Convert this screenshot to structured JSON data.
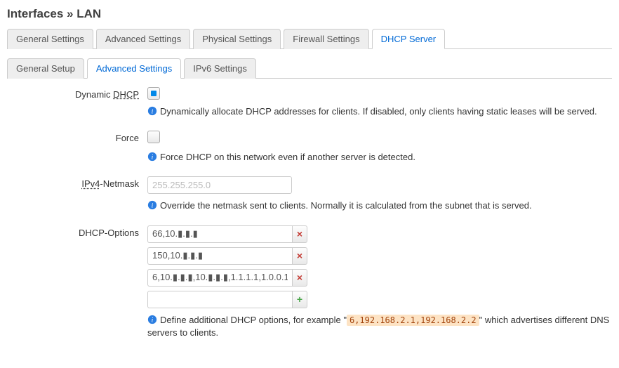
{
  "page_title_prefix": "Interfaces",
  "page_title_sep": " » ",
  "page_title_suffix": "LAN",
  "main_tabs": [
    {
      "label": "General Settings",
      "active": false
    },
    {
      "label": "Advanced Settings",
      "active": false
    },
    {
      "label": "Physical Settings",
      "active": false
    },
    {
      "label": "Firewall Settings",
      "active": false
    },
    {
      "label": "DHCP Server",
      "active": true
    }
  ],
  "sub_tabs": [
    {
      "label": "General Setup",
      "active": false
    },
    {
      "label": "Advanced Settings",
      "active": true
    },
    {
      "label": "IPv6 Settings",
      "active": false
    }
  ],
  "fields": {
    "dynamic_dhcp": {
      "label_pre": "Dynamic ",
      "label_abbr": "DHCP",
      "checked": true,
      "hint": "Dynamically allocate DHCP addresses for clients. If disabled, only clients having static leases will be served."
    },
    "force": {
      "label": "Force",
      "checked": false,
      "hint": "Force DHCP on this network even if another server is detected."
    },
    "ipv4_netmask": {
      "label_abbr": "IPv4",
      "label_post": "-Netmask",
      "placeholder": "255.255.255.0",
      "value": "",
      "hint": "Override the netmask sent to clients. Normally it is calculated from the subnet that is served."
    },
    "dhcp_options": {
      "label": "DHCP-Options",
      "entries": [
        "66,10.▮.▮.▮",
        "150,10.▮.▮.▮",
        "6,10.▮.▮.▮,10.▮.▮.▮,1.1.1.1,1.0.0.1"
      ],
      "hint_pre": "Define additional DHCP options, for example \"",
      "hint_code": "6,192.168.2.1,192.168.2.2",
      "hint_post": "\" which advertises different DNS servers to clients."
    }
  }
}
